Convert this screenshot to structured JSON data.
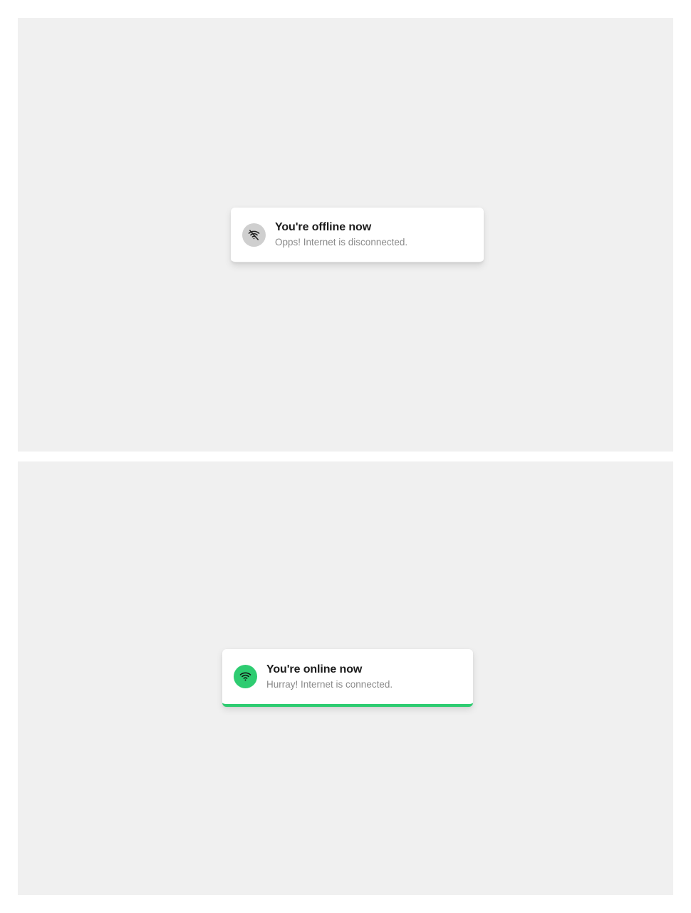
{
  "offline_toast": {
    "title": "You're offline now",
    "message": "Opps! Internet is disconnected.",
    "icon": "wifi-off-icon",
    "icon_bg_color": "#cfcfcf",
    "accent_color": "#d8d8d8"
  },
  "online_toast": {
    "title": "You're online now",
    "message": "Hurray! Internet is connected.",
    "icon": "wifi-icon",
    "icon_bg_color": "#2ecc71",
    "accent_color": "#2ecc71"
  },
  "colors": {
    "panel_background": "#f0f0f0",
    "page_background": "#ffffff"
  }
}
